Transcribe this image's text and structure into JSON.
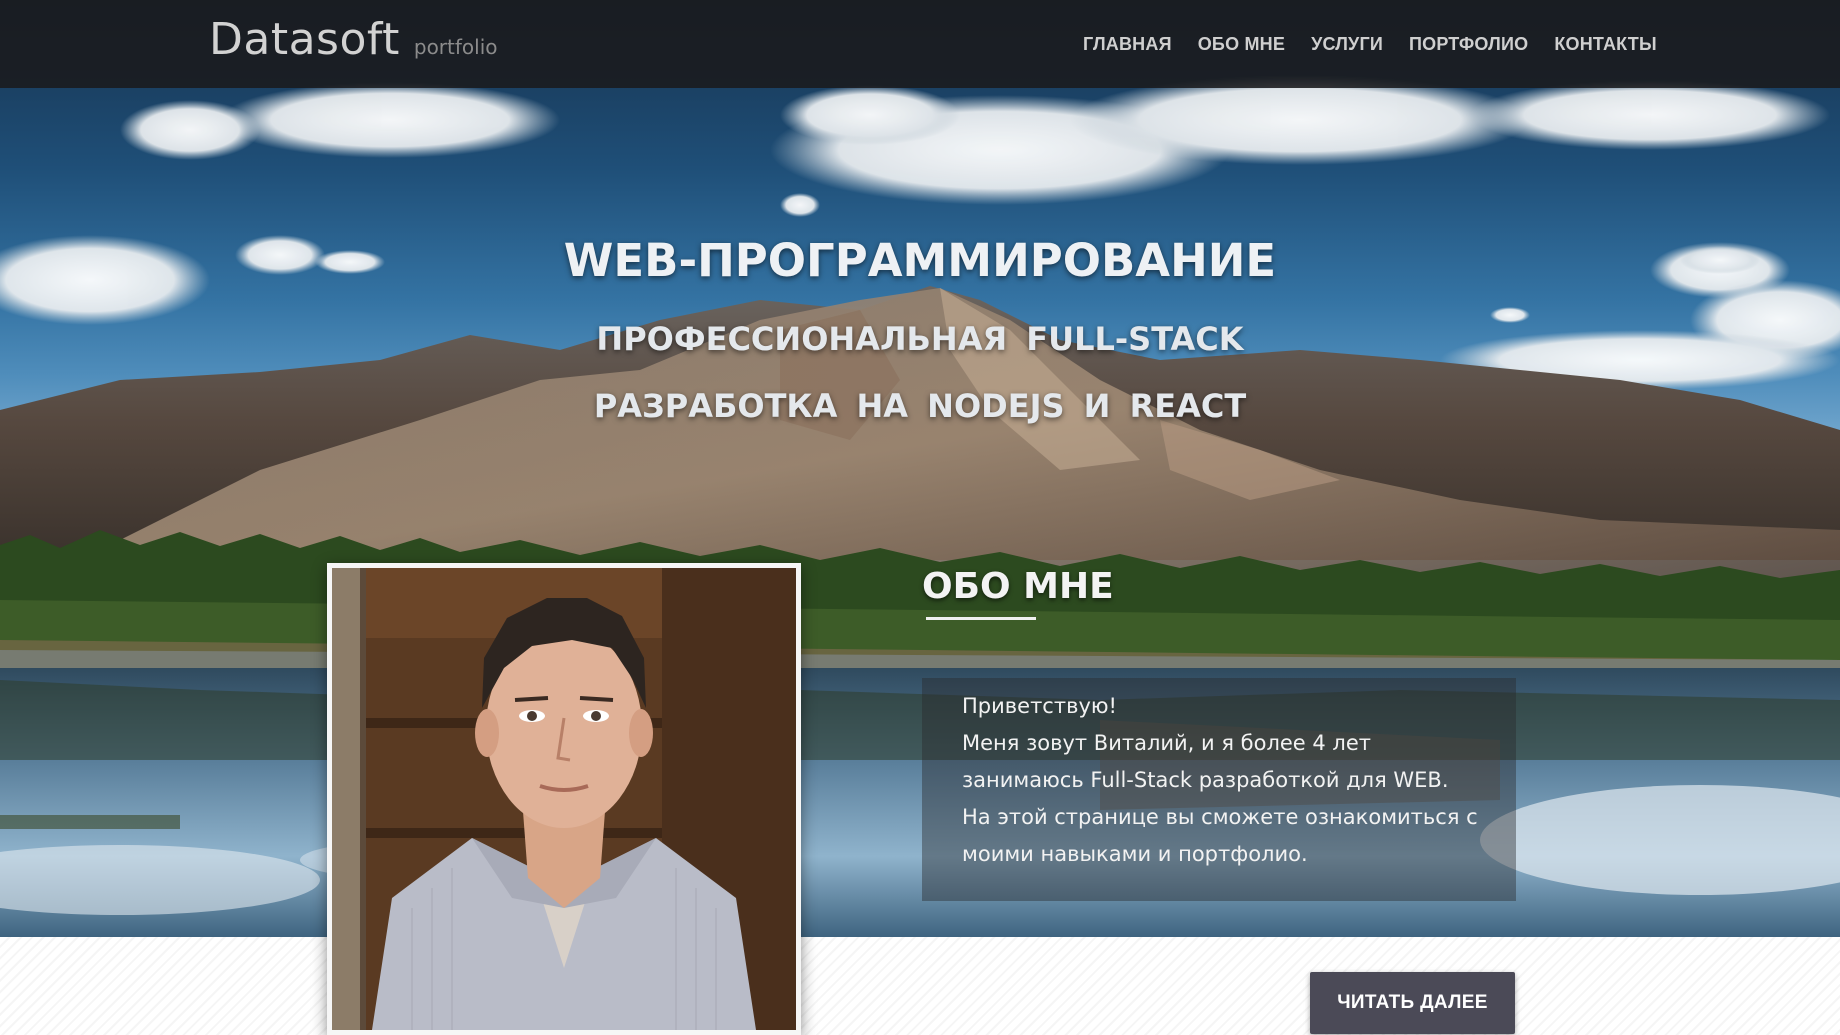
{
  "header": {
    "logo_main": "Datasoft",
    "logo_sub": "portfolio",
    "nav": [
      {
        "label": "ГЛАВНАЯ"
      },
      {
        "label": "ОБО МНЕ"
      },
      {
        "label": "УСЛУГИ"
      },
      {
        "label": "ПОРТФОЛИО"
      },
      {
        "label": "КОНТАКТЫ"
      }
    ]
  },
  "hero": {
    "title": "WEB-ПРОГРАММИРОВАНИЕ",
    "subtitle": "ПРОФЕССИОНАЛЬНАЯ FULL-STACK РАЗРАБОТКА НА NODEJS И REACT"
  },
  "about": {
    "title": "ОБО МНЕ",
    "lines": [
      "Приветствую!",
      "Меня зовут Виталий, и я более 4 лет",
      "занимаюсь Full-Stack разработкой для WEB.",
      "На этой странице вы сможете ознакомиться с",
      "моими навыками и портфолио."
    ],
    "button_label": "ЧИТАТЬ ДАЛЕЕ"
  },
  "colors": {
    "header_bg": "#1a1a1c",
    "button_bg": "#4b4a57",
    "text_light": "#f2f2f2"
  }
}
